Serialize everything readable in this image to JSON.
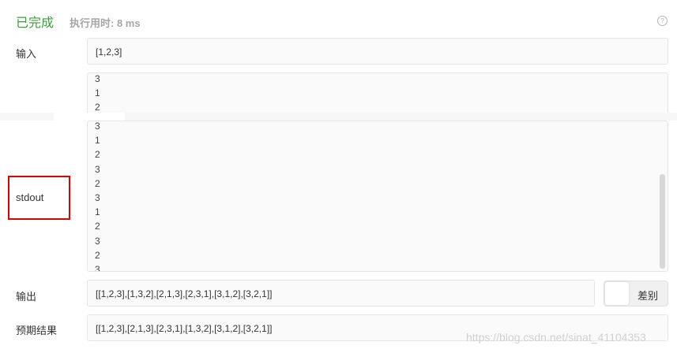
{
  "header": {
    "status": "已完成",
    "runtime": "执行用时: 8 ms",
    "help_icon": "question-circle-icon"
  },
  "input": {
    "label": "输入",
    "value": "[1,2,3]"
  },
  "stdout": {
    "label": "stdout",
    "lines_top": [
      "3",
      "1",
      "2"
    ],
    "lines_main": [
      "3",
      "1",
      "2",
      "3",
      "2",
      "3",
      "1",
      "2",
      "3",
      "2",
      "3"
    ]
  },
  "output": {
    "label": "输出",
    "value": "[[1,2,3],[1,3,2],[2,1,3],[2,3,1],[3,1,2],[3,2,1]]"
  },
  "diff": {
    "label": "差别"
  },
  "expected": {
    "label": "预期结果",
    "value": "[[1,2,3],[2,1,3],[2,3,1],[1,3,2],[3,1,2],[3,2,1]]"
  },
  "watermark": "https://blog.csdn.net/sinat_41104353",
  "colors": {
    "success": "#3d9b3d",
    "highlight": "#e00000"
  }
}
